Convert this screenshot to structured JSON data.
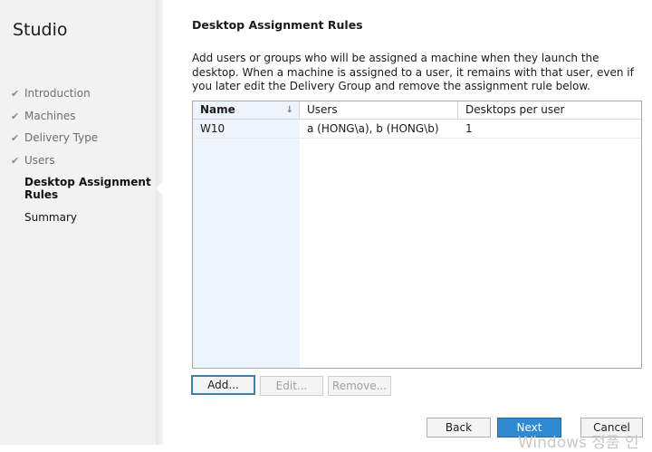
{
  "sidebar": {
    "title": "Studio",
    "steps": [
      {
        "label": "Introduction",
        "done": true
      },
      {
        "label": "Machines",
        "done": true
      },
      {
        "label": "Delivery Type",
        "done": true
      },
      {
        "label": "Users",
        "done": true
      },
      {
        "label": "Desktop Assignment Rules",
        "active": true
      },
      {
        "label": "Summary"
      }
    ]
  },
  "content": {
    "title": "Desktop Assignment Rules",
    "description": "Add users or groups who will be assigned a machine when they launch the desktop. When a machine is assigned to a user, it remains with that user, even if you later edit the Delivery Group and remove the assignment rule below."
  },
  "table": {
    "columns": [
      "Name",
      "Users",
      "Desktops per user"
    ],
    "rows": [
      {
        "name": "W10",
        "users": "a (HONG\\a), b (HONG\\b)",
        "desktops": "1"
      }
    ]
  },
  "buttons": {
    "add": "Add...",
    "edit": "Edit...",
    "remove": "Remove...",
    "back": "Back",
    "next": "Next",
    "cancel": "Cancel"
  },
  "watermark": "Windows 정품 인"
}
